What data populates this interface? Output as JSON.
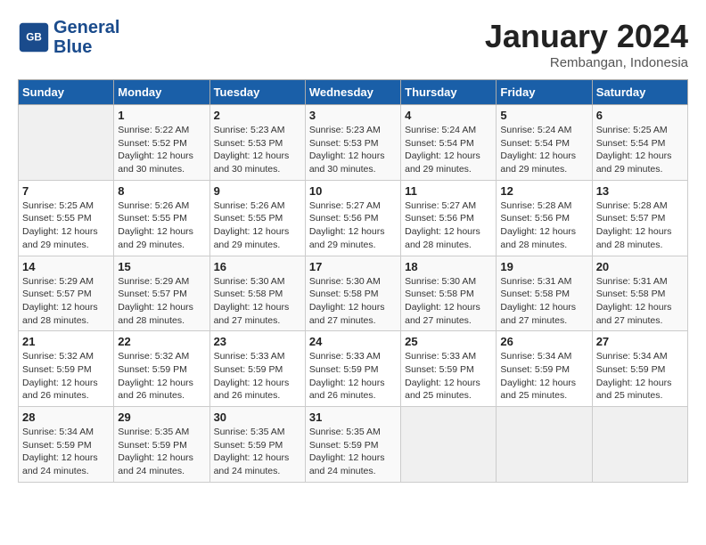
{
  "header": {
    "logo_line1": "General",
    "logo_line2": "Blue",
    "month": "January 2024",
    "location": "Rembangan, Indonesia"
  },
  "days_of_week": [
    "Sunday",
    "Monday",
    "Tuesday",
    "Wednesday",
    "Thursday",
    "Friday",
    "Saturday"
  ],
  "weeks": [
    [
      {
        "day": "",
        "info": ""
      },
      {
        "day": "1",
        "info": "Sunrise: 5:22 AM\nSunset: 5:52 PM\nDaylight: 12 hours\nand 30 minutes."
      },
      {
        "day": "2",
        "info": "Sunrise: 5:23 AM\nSunset: 5:53 PM\nDaylight: 12 hours\nand 30 minutes."
      },
      {
        "day": "3",
        "info": "Sunrise: 5:23 AM\nSunset: 5:53 PM\nDaylight: 12 hours\nand 30 minutes."
      },
      {
        "day": "4",
        "info": "Sunrise: 5:24 AM\nSunset: 5:54 PM\nDaylight: 12 hours\nand 29 minutes."
      },
      {
        "day": "5",
        "info": "Sunrise: 5:24 AM\nSunset: 5:54 PM\nDaylight: 12 hours\nand 29 minutes."
      },
      {
        "day": "6",
        "info": "Sunrise: 5:25 AM\nSunset: 5:54 PM\nDaylight: 12 hours\nand 29 minutes."
      }
    ],
    [
      {
        "day": "7",
        "info": "Sunrise: 5:25 AM\nSunset: 5:55 PM\nDaylight: 12 hours\nand 29 minutes."
      },
      {
        "day": "8",
        "info": "Sunrise: 5:26 AM\nSunset: 5:55 PM\nDaylight: 12 hours\nand 29 minutes."
      },
      {
        "day": "9",
        "info": "Sunrise: 5:26 AM\nSunset: 5:55 PM\nDaylight: 12 hours\nand 29 minutes."
      },
      {
        "day": "10",
        "info": "Sunrise: 5:27 AM\nSunset: 5:56 PM\nDaylight: 12 hours\nand 29 minutes."
      },
      {
        "day": "11",
        "info": "Sunrise: 5:27 AM\nSunset: 5:56 PM\nDaylight: 12 hours\nand 28 minutes."
      },
      {
        "day": "12",
        "info": "Sunrise: 5:28 AM\nSunset: 5:56 PM\nDaylight: 12 hours\nand 28 minutes."
      },
      {
        "day": "13",
        "info": "Sunrise: 5:28 AM\nSunset: 5:57 PM\nDaylight: 12 hours\nand 28 minutes."
      }
    ],
    [
      {
        "day": "14",
        "info": "Sunrise: 5:29 AM\nSunset: 5:57 PM\nDaylight: 12 hours\nand 28 minutes."
      },
      {
        "day": "15",
        "info": "Sunrise: 5:29 AM\nSunset: 5:57 PM\nDaylight: 12 hours\nand 28 minutes."
      },
      {
        "day": "16",
        "info": "Sunrise: 5:30 AM\nSunset: 5:58 PM\nDaylight: 12 hours\nand 27 minutes."
      },
      {
        "day": "17",
        "info": "Sunrise: 5:30 AM\nSunset: 5:58 PM\nDaylight: 12 hours\nand 27 minutes."
      },
      {
        "day": "18",
        "info": "Sunrise: 5:30 AM\nSunset: 5:58 PM\nDaylight: 12 hours\nand 27 minutes."
      },
      {
        "day": "19",
        "info": "Sunrise: 5:31 AM\nSunset: 5:58 PM\nDaylight: 12 hours\nand 27 minutes."
      },
      {
        "day": "20",
        "info": "Sunrise: 5:31 AM\nSunset: 5:58 PM\nDaylight: 12 hours\nand 27 minutes."
      }
    ],
    [
      {
        "day": "21",
        "info": "Sunrise: 5:32 AM\nSunset: 5:59 PM\nDaylight: 12 hours\nand 26 minutes."
      },
      {
        "day": "22",
        "info": "Sunrise: 5:32 AM\nSunset: 5:59 PM\nDaylight: 12 hours\nand 26 minutes."
      },
      {
        "day": "23",
        "info": "Sunrise: 5:33 AM\nSunset: 5:59 PM\nDaylight: 12 hours\nand 26 minutes."
      },
      {
        "day": "24",
        "info": "Sunrise: 5:33 AM\nSunset: 5:59 PM\nDaylight: 12 hours\nand 26 minutes."
      },
      {
        "day": "25",
        "info": "Sunrise: 5:33 AM\nSunset: 5:59 PM\nDaylight: 12 hours\nand 25 minutes."
      },
      {
        "day": "26",
        "info": "Sunrise: 5:34 AM\nSunset: 5:59 PM\nDaylight: 12 hours\nand 25 minutes."
      },
      {
        "day": "27",
        "info": "Sunrise: 5:34 AM\nSunset: 5:59 PM\nDaylight: 12 hours\nand 25 minutes."
      }
    ],
    [
      {
        "day": "28",
        "info": "Sunrise: 5:34 AM\nSunset: 5:59 PM\nDaylight: 12 hours\nand 24 minutes."
      },
      {
        "day": "29",
        "info": "Sunrise: 5:35 AM\nSunset: 5:59 PM\nDaylight: 12 hours\nand 24 minutes."
      },
      {
        "day": "30",
        "info": "Sunrise: 5:35 AM\nSunset: 5:59 PM\nDaylight: 12 hours\nand 24 minutes."
      },
      {
        "day": "31",
        "info": "Sunrise: 5:35 AM\nSunset: 5:59 PM\nDaylight: 12 hours\nand 24 minutes."
      },
      {
        "day": "",
        "info": ""
      },
      {
        "day": "",
        "info": ""
      },
      {
        "day": "",
        "info": ""
      }
    ]
  ]
}
